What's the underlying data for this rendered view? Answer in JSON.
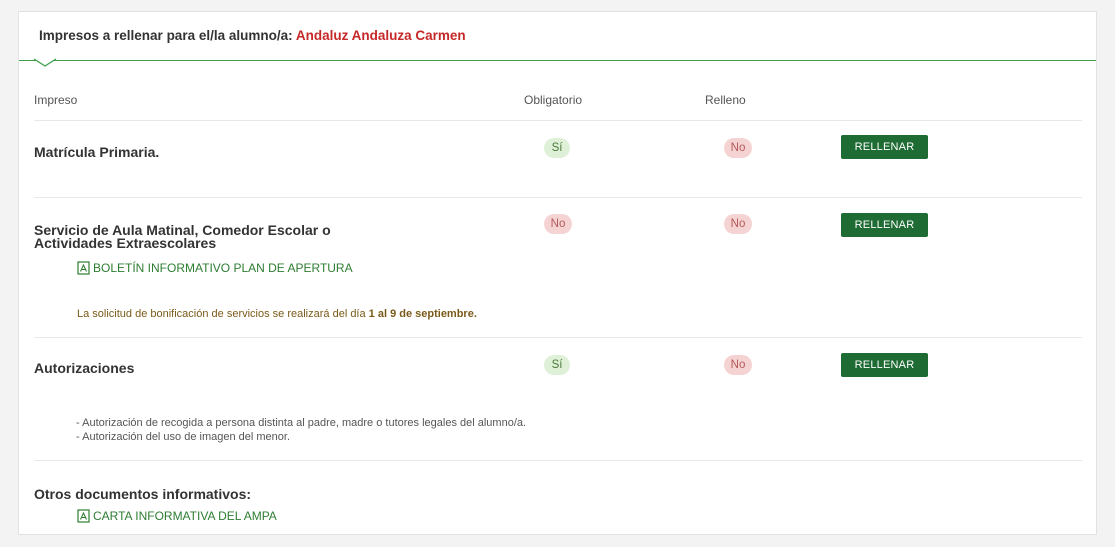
{
  "header": {
    "title_prefix": "Impresos a rellenar para el/la alumno/a:",
    "student_name": "Andaluz Andaluza Carmen"
  },
  "columns": {
    "impreso": "Impreso",
    "obligatorio": "Obligatorio",
    "relleno": "Relleno"
  },
  "rows": [
    {
      "title": "Matrícula Primaria.",
      "obligatorio": "Sí",
      "relleno": "No",
      "button": "RELLENAR"
    },
    {
      "title_line1": "Servicio de Aula Matinal, Comedor Escolar o",
      "title_line2": "Actividades Extraescolares",
      "obligatorio": "No",
      "relleno": "No",
      "button": "RELLENAR",
      "link": "BOLETÍN INFORMATIVO PLAN DE APERTURA",
      "note_prefix": "La solicitud de bonificación de servicios se realizará del día",
      "note_bold": "1 al 9 de septiembre."
    },
    {
      "title": "Autorizaciones",
      "obligatorio": "Sí",
      "relleno": "No",
      "button": "RELLENAR",
      "details": [
        "- Autorización de recogida a persona distinta al padre, madre o tutores legales del alumno/a.",
        "- Autorización del uso de imagen del menor."
      ]
    }
  ],
  "others": {
    "title": "Otros documentos informativos:",
    "link": "CARTA INFORMATIVA DEL AMPA"
  },
  "colors": {
    "accent_green": "#1e6b34",
    "student_red": "#c62828",
    "yes_badge_bg": "#dff0d8",
    "no_badge_bg": "#f6d3d3"
  }
}
